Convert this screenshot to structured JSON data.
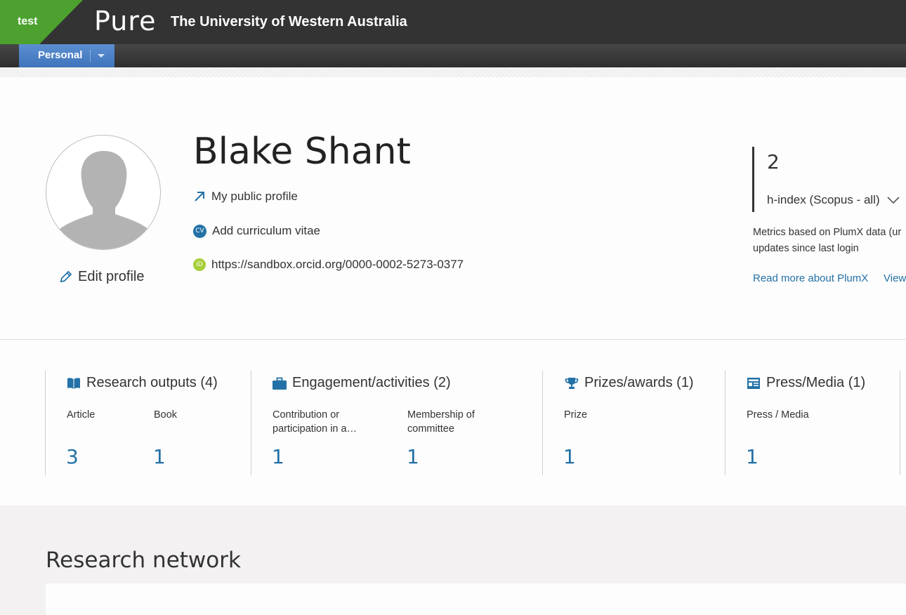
{
  "header": {
    "env_label": "test",
    "logo": "Pure",
    "org_title": "The University of Western Australia"
  },
  "nav": {
    "tab_label": "Personal"
  },
  "profile": {
    "name": "Blake Shant",
    "edit_label": "Edit profile",
    "public_profile_label": "My public profile",
    "cv_label": "Add curriculum vitae",
    "cv_badge": "CV",
    "orcid_url": "https://sandbox.orcid.org/0000-0002-5273-0377",
    "orcid_badge": "iD"
  },
  "metrics": {
    "value": "2",
    "label": "h-index (Scopus - all)",
    "note_line1": "Metrics based on PlumX data (ur",
    "note_line2": "updates since last login",
    "plumx_link": "Read more about PlumX",
    "view_link": "View"
  },
  "stats": [
    {
      "title": "Research outputs (4)",
      "icon": "book-icon",
      "items": [
        {
          "label": "Article",
          "value": "3"
        },
        {
          "label": "Book",
          "value": "1"
        }
      ]
    },
    {
      "title": "Engagement/activities (2)",
      "icon": "briefcase-icon",
      "items": [
        {
          "label": "Contribution or participation in a…",
          "value": "1"
        },
        {
          "label": "Membership of committee",
          "value": "1"
        }
      ]
    },
    {
      "title": "Prizes/awards (1)",
      "icon": "trophy-icon",
      "items": [
        {
          "label": "Prize",
          "value": "1"
        }
      ]
    },
    {
      "title": "Press/Media (1)",
      "icon": "newspaper-icon",
      "items": [
        {
          "label": "Press / Media",
          "value": "1"
        }
      ]
    }
  ],
  "network": {
    "title": "Research network"
  },
  "colors": {
    "brand_green": "#4ca12f",
    "tab_blue": "#3f74bb",
    "link_blue": "#2371a6",
    "orcid_green": "#a6ce39",
    "header_dark": "#333333"
  }
}
